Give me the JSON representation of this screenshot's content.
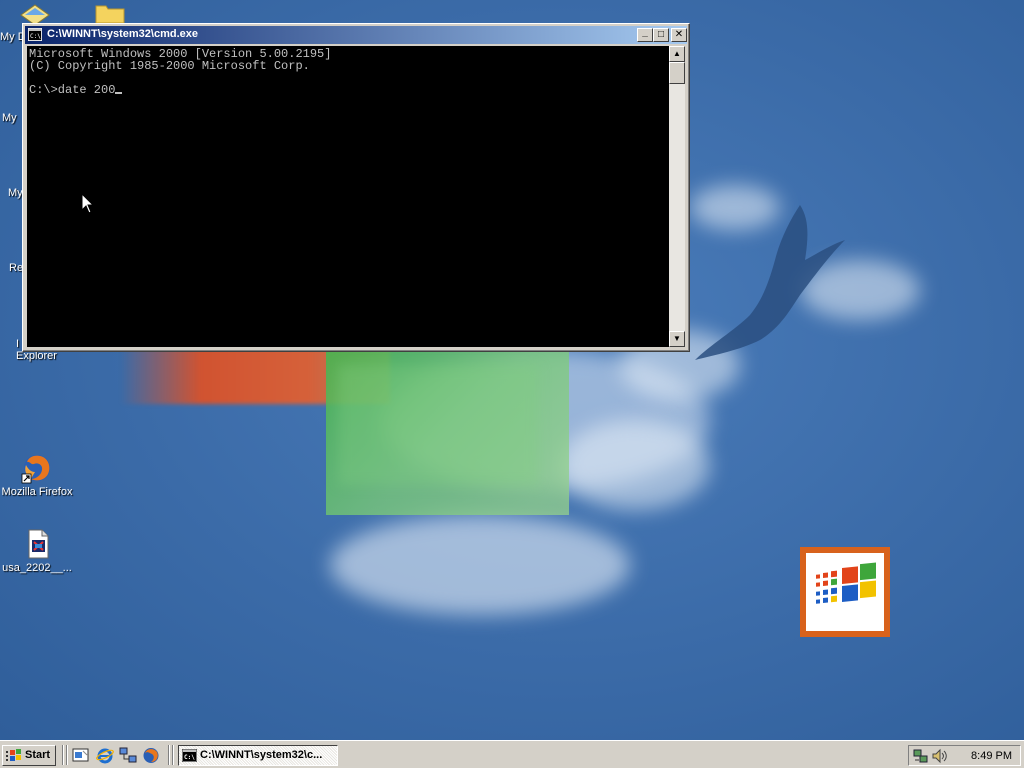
{
  "desktop": {
    "icons": [
      {
        "label": "My D",
        "icon": "my-documents-icon"
      },
      {
        "label": "My",
        "icon": "my-computer-icon"
      },
      {
        "label": "My",
        "icon": "my-network-places-icon"
      },
      {
        "label": "Re",
        "icon": "recycle-bin-icon"
      },
      {
        "label": "I",
        "label2": "Explorer",
        "icon": "internet-explorer-icon"
      },
      {
        "label": "Mozilla Firefox",
        "icon": "firefox-icon"
      },
      {
        "label": "usa_2202__...",
        "icon": "media-file-icon"
      }
    ]
  },
  "cmd_window": {
    "title": "C:\\WINNT\\system32\\cmd.exe",
    "lines": [
      "Microsoft Windows 2000 [Version 5.00.2195]",
      "(C) Copyright 1985-2000 Microsoft Corp.",
      "",
      "C:\\>date 200"
    ],
    "buttons": {
      "minimize": "_",
      "maximize": "□",
      "close": "✕"
    }
  },
  "taskbar": {
    "start_label": "Start",
    "quick_launch": [
      "show-desktop-icon",
      "internet-explorer-icon",
      "network-icon",
      "firefox-icon"
    ],
    "tasks": [
      {
        "label": "C:\\WINNT\\system32\\c...",
        "icon": "cmd-icon"
      }
    ],
    "tray": {
      "icons": [
        "network-connection-icon",
        "volume-icon"
      ],
      "clock": "8:49 PM"
    }
  },
  "colors": {
    "desktop": "#3d6fae",
    "titlebar_start": "#0a246a",
    "titlebar_end": "#a6caf0",
    "console_bg": "#000000",
    "console_fg": "#c0c0c0",
    "chrome": "#d4d0c8",
    "logo_frame": "#d8621c"
  }
}
